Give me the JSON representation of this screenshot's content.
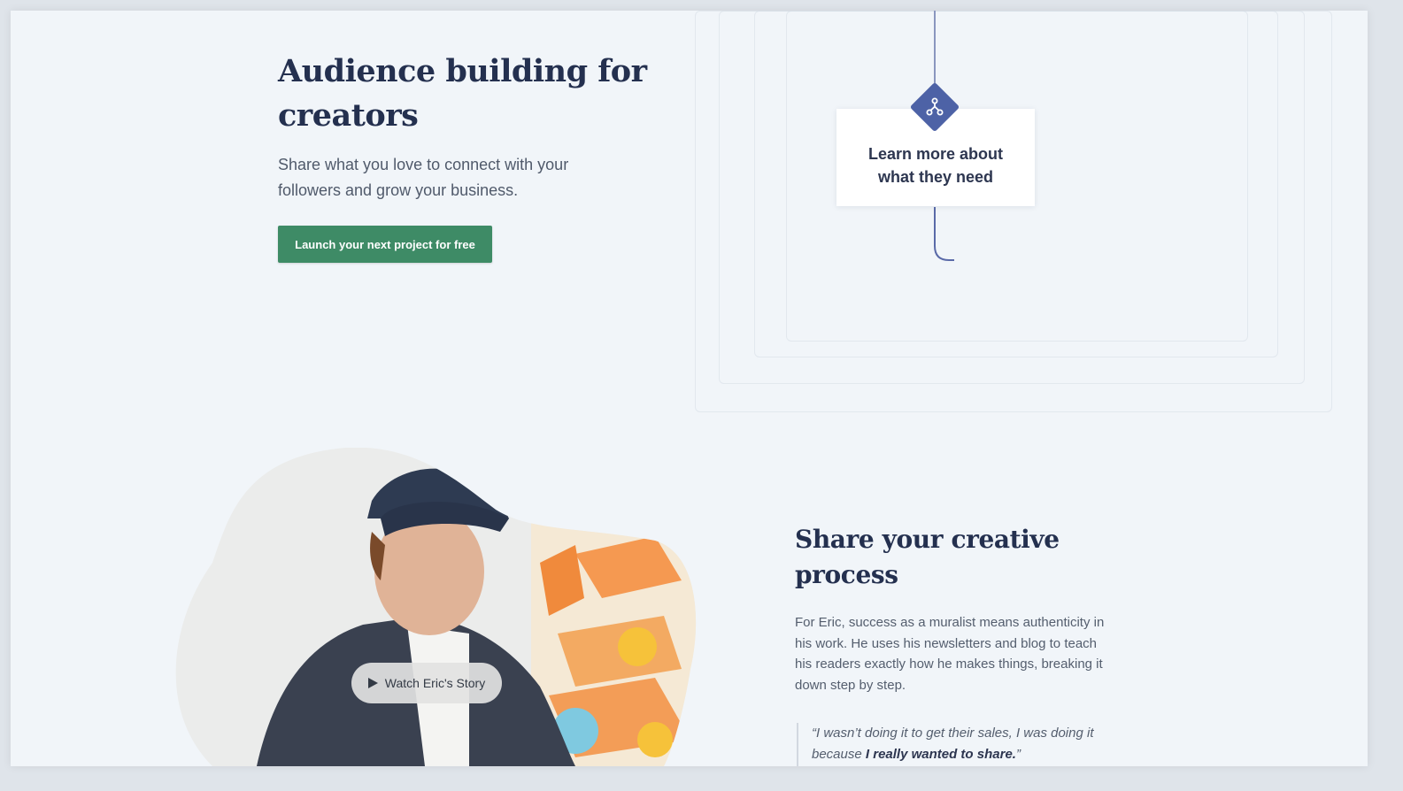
{
  "hero": {
    "title": "Audience building for creators",
    "subtitle": "Share what you love to connect with your followers and grow your business.",
    "cta_label": "Launch your next project for free"
  },
  "flow": {
    "card_label": "Learn more about what they need",
    "icon": "branch-icon",
    "accent_color": "#4d62a6"
  },
  "story": {
    "video_label": "Watch Eric's Story",
    "section_title": "Share your creative process",
    "body": "For Eric, success as a muralist means authenticity in his work. He uses his newsletters and blog to teach his readers exactly how he makes things, breaking it down step by step.",
    "quote_start": "“I wasn’t doing it to get their sales, I was doing it because ",
    "quote_emphasis": "I really wanted to share.",
    "quote_end": "”"
  },
  "colors": {
    "background": "#f1f5f9",
    "heading": "#24304f",
    "cta_green": "#3e8b66"
  }
}
